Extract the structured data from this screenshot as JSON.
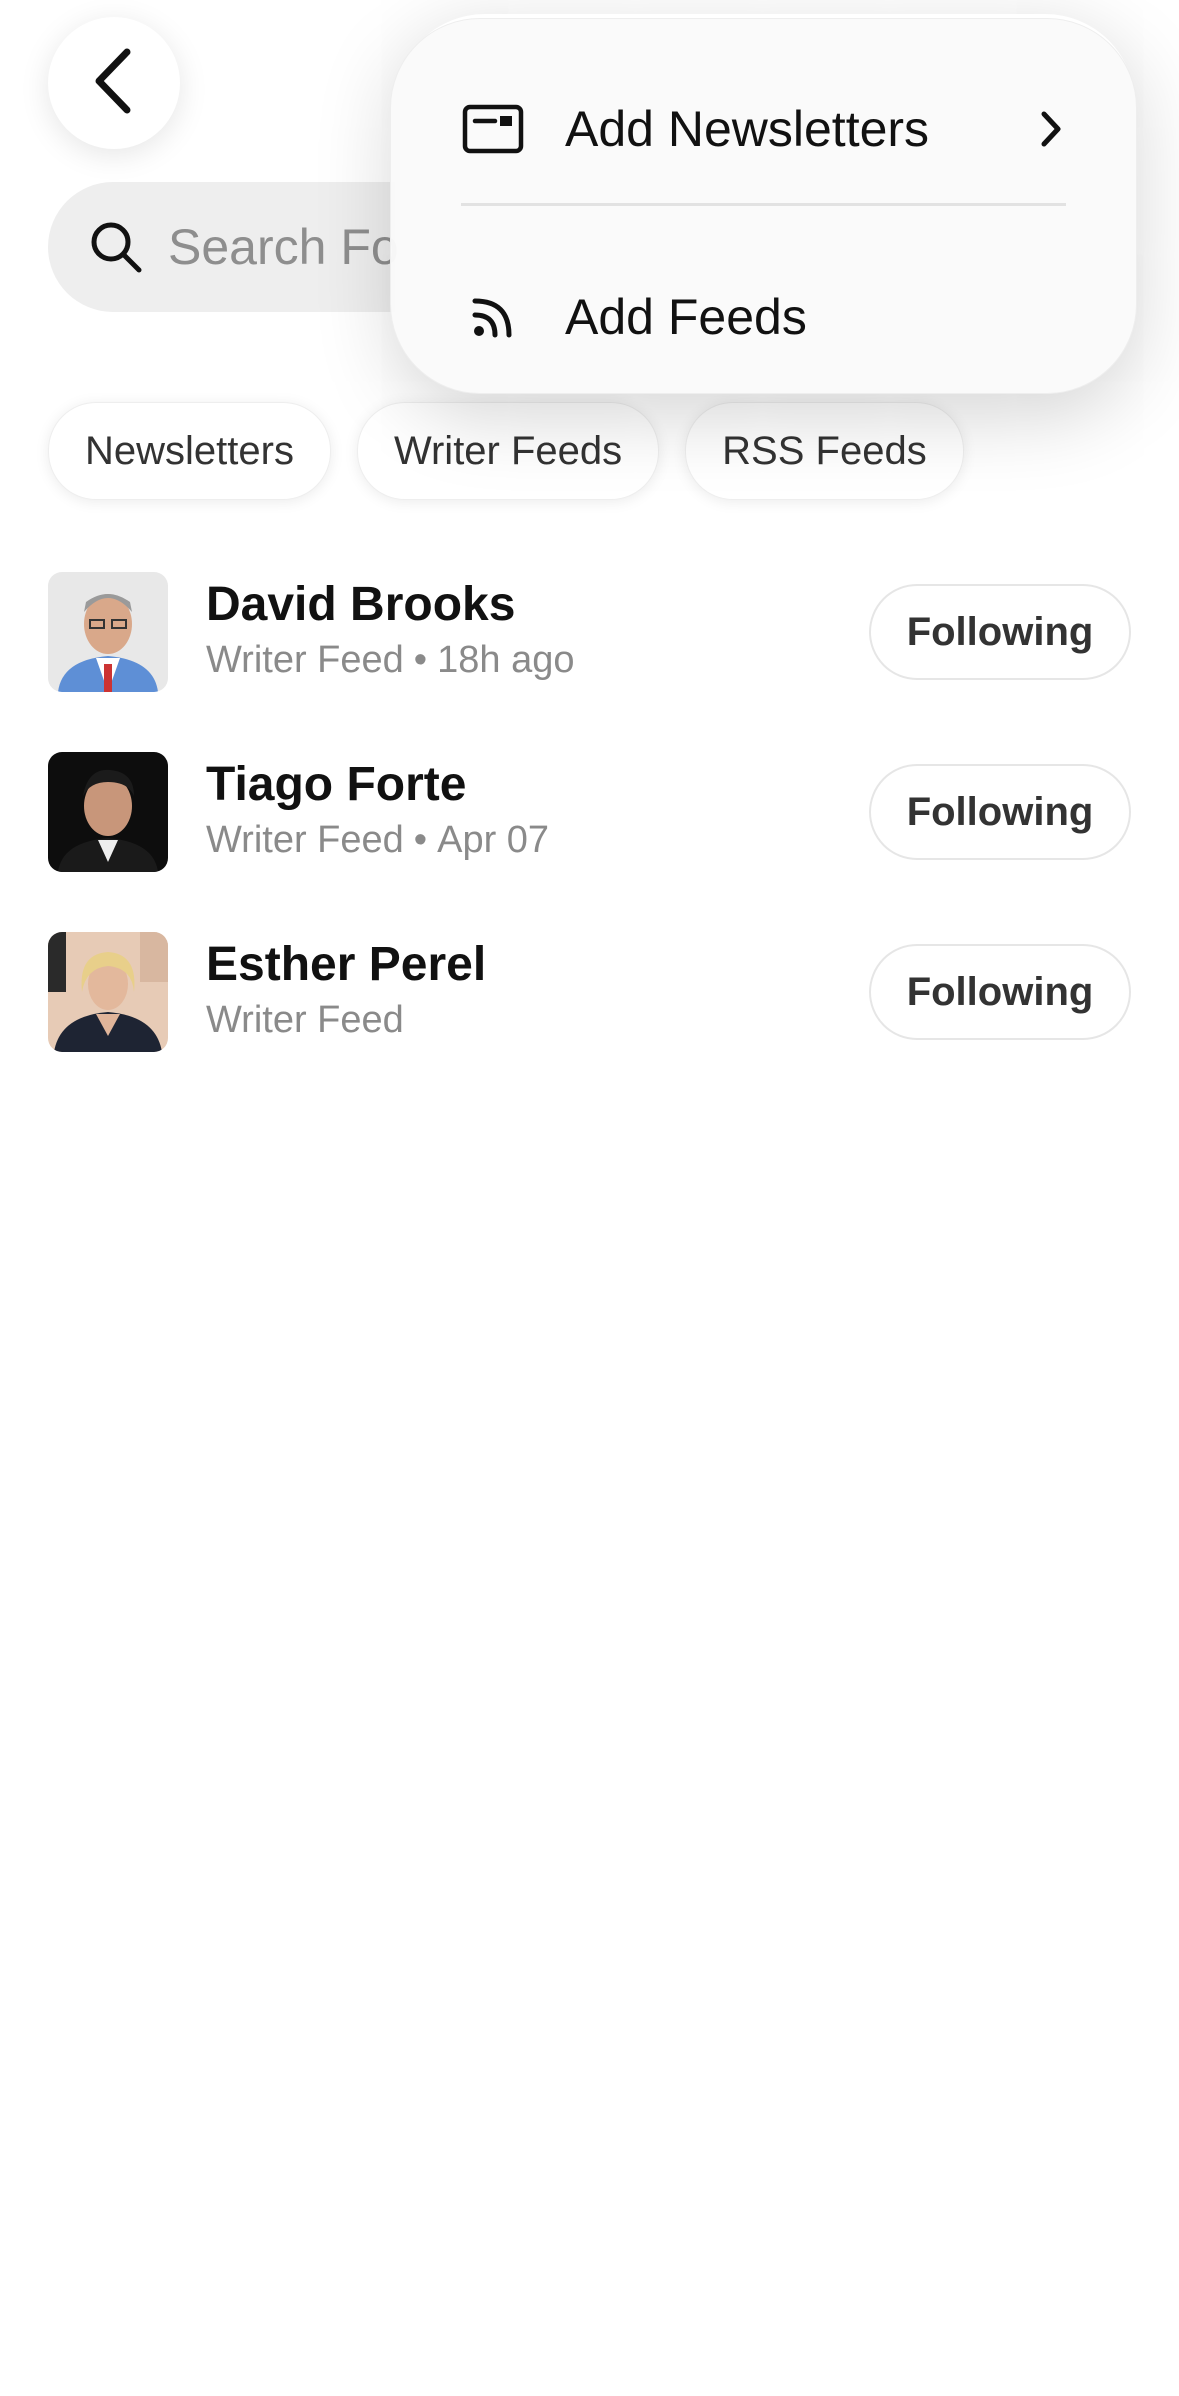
{
  "header": {
    "back_icon": "chevron-left-icon"
  },
  "search": {
    "placeholder": "Search Fo",
    "icon": "search-icon"
  },
  "filters": [
    {
      "label": "Newsletters"
    },
    {
      "label": "Writer Feeds"
    },
    {
      "label": "RSS Feeds"
    }
  ],
  "feeds": [
    {
      "name": "David Brooks",
      "type": "Writer Feed",
      "separator": "•",
      "time": "18h ago",
      "button": "Following"
    },
    {
      "name": "Tiago Forte",
      "type": "Writer Feed",
      "separator": "•",
      "time": "Apr 07",
      "button": "Following"
    },
    {
      "name": "Esther Perel",
      "type": "Writer Feed",
      "separator": "",
      "time": "",
      "button": "Following"
    }
  ],
  "menu": {
    "items": [
      {
        "label": "Add Newsletters",
        "icon": "newsletter-card-icon",
        "trailing": "chevron-right-icon"
      },
      {
        "label": "Add Feeds",
        "icon": "rss-icon",
        "trailing": ""
      }
    ]
  },
  "colors": {
    "background": "#ffffff",
    "search_fill": "#eeeeee",
    "secondary_text": "#8a8a8a",
    "primary_text": "#111111"
  }
}
